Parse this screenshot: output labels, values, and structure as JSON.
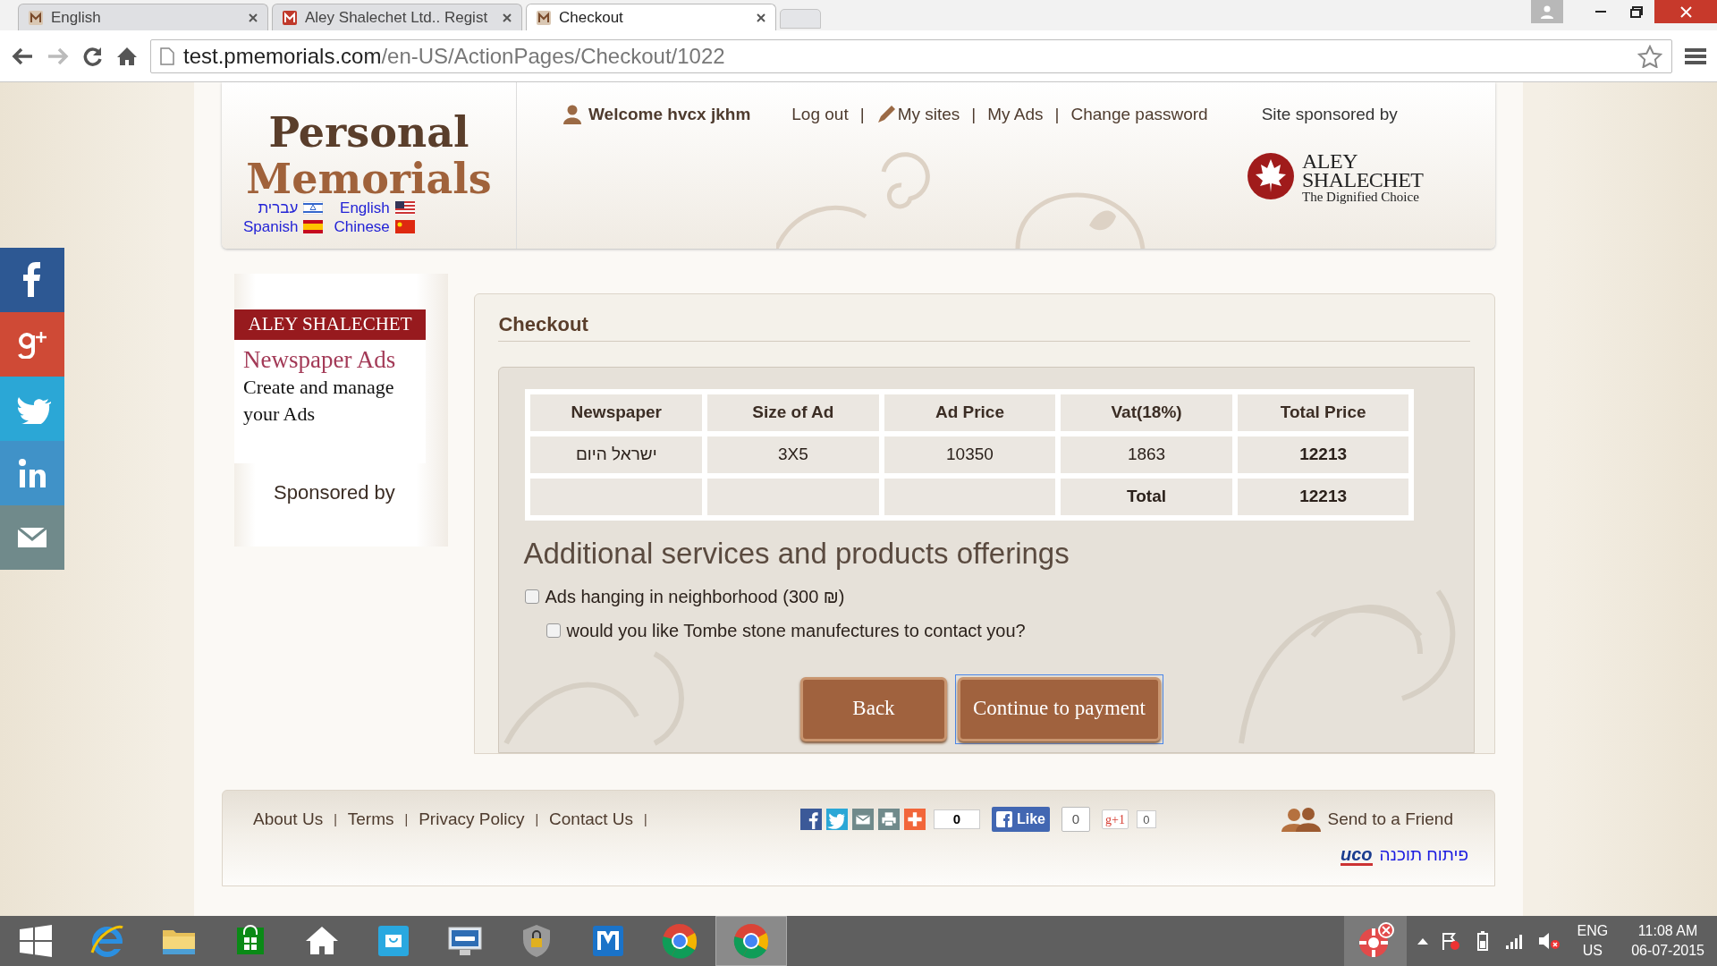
{
  "browser": {
    "tabs": [
      {
        "title": "English",
        "selected": false
      },
      {
        "title": "Aley Shalechet Ltd.. Regist",
        "selected": false
      },
      {
        "title": "Checkout",
        "selected": true
      }
    ],
    "url_host": "test.pmemorials.com",
    "url_path": "/en-US/ActionPages/Checkout/1022"
  },
  "header": {
    "logo_lines": [
      "Personal",
      "Memorials"
    ],
    "languages": [
      {
        "label": "עברית"
      },
      {
        "label": "English"
      },
      {
        "label": "Spanish"
      },
      {
        "label": "Chinese"
      }
    ],
    "welcome": "Welcome hvcx jkhm",
    "nav": [
      {
        "label": "Log out"
      },
      {
        "label": "My sites"
      },
      {
        "label": "My Ads"
      },
      {
        "label": "Change password"
      }
    ],
    "nav_separators": [
      "|",
      "|",
      "|"
    ],
    "sponsor_label": "Site sponsored by",
    "sponsor_logo": [
      "ALEY",
      "SHALECHET",
      "The Dignified Choice"
    ]
  },
  "ad_panel": {
    "banner": "ALEY SHALECHET",
    "title": "Newspaper Ads",
    "text": "Create and manage your Ads",
    "sponsored": "Sponsored by"
  },
  "checkout": {
    "title": "Checkout",
    "table": {
      "columns": [
        "Newspaper",
        "Size of Ad",
        "Ad Price",
        "Vat(18%)",
        "Total Price"
      ],
      "rows": [
        [
          "ישראל היום",
          "3X5",
          "10350",
          "1863",
          "12213"
        ],
        [
          "",
          "",
          "",
          "Total",
          "12213"
        ]
      ]
    },
    "subheading": "Additional services and products offerings",
    "options": [
      {
        "label": "Ads hanging in neighborhood (300 ₪)",
        "checked": false
      },
      {
        "label": "would you like Tombe stone manufectures to contact you?",
        "checked": false
      }
    ],
    "buttons": [
      {
        "label": "Back",
        "focused": false
      },
      {
        "label": "Continue to payment",
        "focused": true
      }
    ]
  },
  "footer": {
    "links": [
      "About Us",
      "Terms",
      "Privacy Policy",
      "Contact Us"
    ],
    "link_separators": [
      "|",
      "|",
      "|",
      "|"
    ],
    "share_count": "0",
    "like_label": "Like",
    "like_count": "0",
    "gplus_label": "g+1",
    "gplus_count": "0",
    "send": "Send to a Friend",
    "credit_logo": "uco",
    "credit": "פיתוח תוכנה"
  },
  "taskbar": {
    "lang": "ENG",
    "region": "US",
    "time": "11:08 AM",
    "date": "06-07-2015"
  }
}
